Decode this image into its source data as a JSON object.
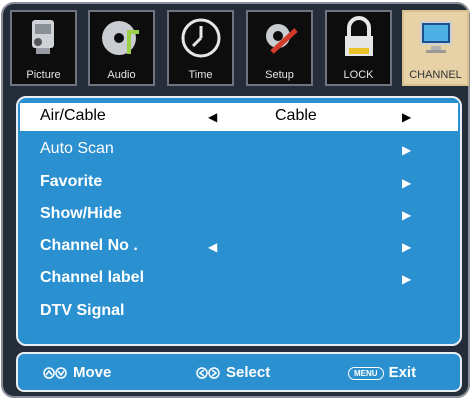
{
  "tabs": [
    {
      "label": "Picture",
      "icon": "camcorder-icon"
    },
    {
      "label": "Audio",
      "icon": "cd-music-icon"
    },
    {
      "label": "Time",
      "icon": "clock-icon"
    },
    {
      "label": "Setup",
      "icon": "gear-tools-icon"
    },
    {
      "label": "LOCK",
      "icon": "padlock-icon"
    },
    {
      "label": "CHANNEL",
      "icon": "monitor-icon"
    }
  ],
  "active_tab": "CHANNEL",
  "menu": {
    "items": [
      {
        "label": "Air/Cable",
        "value": "Cable"
      },
      {
        "label": "Auto Scan"
      },
      {
        "label": "Favorite"
      },
      {
        "label": "Show/Hide"
      },
      {
        "label": "Channel No ."
      },
      {
        "label": "Channel label"
      },
      {
        "label": "DTV Signal"
      }
    ]
  },
  "footer": {
    "move": "Move",
    "select": "Select",
    "menu_key": "MENU",
    "exit": "Exit"
  },
  "colors": {
    "panel_blue": "#2a90cf",
    "frame_dark": "#262d3a",
    "active_tab": "#e7d2a7"
  }
}
